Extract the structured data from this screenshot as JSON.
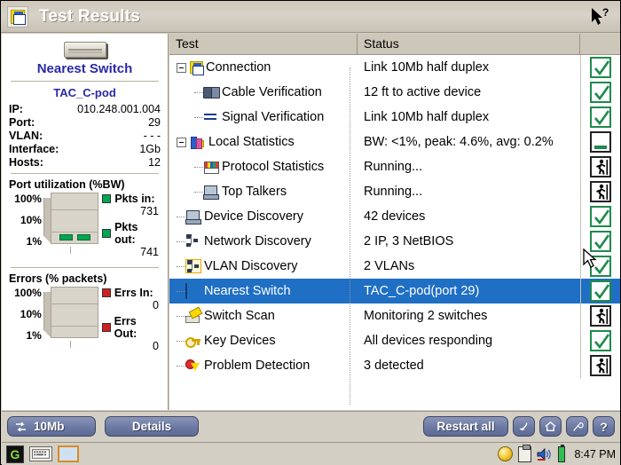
{
  "window": {
    "title": "Test Results",
    "title_icon": "notepad-icon",
    "help_icon": "help-pointer-icon"
  },
  "left_panel": {
    "device_icon": "switch-device-icon",
    "heading": "Nearest Switch",
    "subheading": "TAC_C-pod",
    "fields": [
      {
        "label": "IP:",
        "value": "010.248.001.004"
      },
      {
        "label": "Port:",
        "value": "29"
      },
      {
        "label": "VLAN:",
        "value": "- - -"
      },
      {
        "label": "Interface:",
        "value": "1Gb"
      },
      {
        "label": "Hosts:",
        "value": "12"
      }
    ],
    "utilization": {
      "title": "Port utilization (%BW)",
      "scale": [
        "100%",
        "10%",
        "1%"
      ],
      "legend": [
        {
          "label": "Pkts in:",
          "value": "731",
          "color": "#00a651"
        },
        {
          "label": "Pkts out:",
          "value": "741",
          "color": "#00a651"
        }
      ]
    },
    "errors": {
      "title": "Errors (% packets)",
      "scale": [
        "100%",
        "10%",
        "1%"
      ],
      "legend": [
        {
          "label": "Errs In:",
          "value": "0",
          "color": "#d02020"
        },
        {
          "label": "Errs Out:",
          "value": "0",
          "color": "#d02020"
        }
      ]
    }
  },
  "tree": {
    "columns": {
      "test": "Test",
      "status": "Status",
      "result": ""
    },
    "rows": [
      {
        "test": "Connection",
        "status": "Link 10Mb half duplex",
        "icon": "connection-icon",
        "indent": 0,
        "expander": "minus",
        "result": "pass",
        "selected": false
      },
      {
        "test": "Cable Verification",
        "status": "12 ft to active device",
        "icon": "cable-icon",
        "indent": 1,
        "expander": "none",
        "result": "pass",
        "selected": false
      },
      {
        "test": "Signal Verification",
        "status": "Link 10Mb half duplex",
        "icon": "signal-icon",
        "indent": 1,
        "expander": "none",
        "result": "pass",
        "selected": false
      },
      {
        "test": "Local Statistics",
        "status": "BW: <1%, peak: 4.6%, avg: 0.2%",
        "icon": "statistics-icon",
        "indent": 0,
        "expander": "minus",
        "result": "bar",
        "selected": false
      },
      {
        "test": "Protocol Statistics",
        "status": "Running...",
        "icon": "protocol-icon",
        "indent": 1,
        "expander": "none",
        "result": "running",
        "selected": false
      },
      {
        "test": "Top Talkers",
        "status": "Running...",
        "icon": "computer-icon",
        "indent": 1,
        "expander": "none",
        "result": "running",
        "selected": false
      },
      {
        "test": "Device Discovery",
        "status": "42 devices",
        "icon": "computer-icon",
        "indent": 0,
        "expander": "none",
        "result": "pass",
        "selected": false
      },
      {
        "test": "Network Discovery",
        "status": "2 IP, 3 NetBIOS",
        "icon": "network-icon",
        "indent": 0,
        "expander": "none",
        "result": "pass",
        "selected": false
      },
      {
        "test": "VLAN Discovery",
        "status": "2 VLANs",
        "icon": "vlan-icon",
        "indent": 0,
        "expander": "none",
        "result": "pass",
        "selected": false
      },
      {
        "test": "Nearest Switch",
        "status": "TAC_C-pod(port 29)",
        "icon": "switch-icon",
        "indent": 0,
        "expander": "none",
        "result": "pass",
        "selected": true
      },
      {
        "test": "Switch Scan",
        "status": "Monitoring 2 switches",
        "icon": "scan-icon",
        "indent": 0,
        "expander": "none",
        "result": "running",
        "selected": false
      },
      {
        "test": "Key Devices",
        "status": "All devices responding",
        "icon": "key-icon",
        "indent": 0,
        "expander": "none",
        "result": "pass",
        "selected": false
      },
      {
        "test": "Problem Detection",
        "status": "3 detected",
        "icon": "problem-icon",
        "indent": 0,
        "expander": "none",
        "result": "running",
        "selected": false
      }
    ]
  },
  "toolbar": {
    "speed_label": "10Mb",
    "speed_icon": "link-speed-icon",
    "details_label": "Details",
    "restart_label": "Restart all",
    "back_icon": "back-arrow-icon",
    "home_icon": "home-icon",
    "tools_icon": "wrench-icon",
    "help_icon": "question-mark-icon"
  },
  "taskbar": {
    "start_icon": "start-icon",
    "keyboard_icon": "keyboard-icon",
    "app_icon": "app-window-icon",
    "bulb_icon": "bulb-icon",
    "clipboard_icon": "clipboard-icon",
    "speaker_icon": "speaker-icon",
    "battery_icon": "battery-icon",
    "clock": "8:47 PM"
  },
  "colors": {
    "selection": "#1f6fc4",
    "pass": "#1f8a4c",
    "accent_blue": "#2a2aa8",
    "chrome": "#d4cfc4"
  },
  "cursor": {
    "position_row": "Network Discovery",
    "icon": "mouse-pointer-icon"
  }
}
